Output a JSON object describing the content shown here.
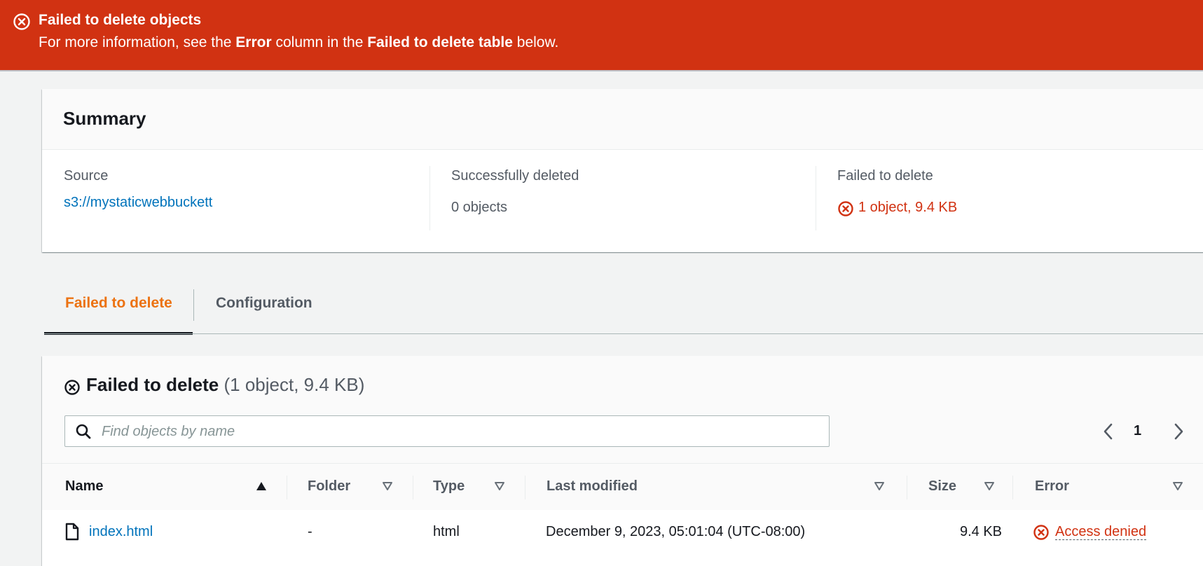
{
  "flash": {
    "title": "Failed to delete objects",
    "msg_prefix": "For more information, see the ",
    "msg_bold1": "Error",
    "msg_mid": " column in the ",
    "msg_bold2": "Failed to delete table",
    "msg_suffix": " below.",
    "icon": "error-circle-x-icon",
    "color": "#d13212"
  },
  "summary": {
    "title": "Summary",
    "source_label": "Source",
    "source_value": "s3://mystaticwebbuckett",
    "success_label": "Successfully deleted",
    "success_value": "0 objects",
    "failed_label": "Failed to delete",
    "failed_value": "1 object, 9.4 KB"
  },
  "tabs": [
    {
      "label": "Failed to delete",
      "active": true
    },
    {
      "label": "Configuration",
      "active": false
    }
  ],
  "failed_table": {
    "title": "Failed to delete",
    "counter": "(1 object, 9.4 KB)",
    "search_placeholder": "Find objects by name",
    "page_number": "1",
    "columns": [
      "Name",
      "Folder",
      "Type",
      "Last modified",
      "Size",
      "Error"
    ],
    "rows": [
      {
        "name": "index.html",
        "folder": "-",
        "type": "html",
        "last_modified": "December 9, 2023, 05:01:04 (UTC-08:00)",
        "size": "9.4 KB",
        "error": "Access denied"
      }
    ]
  },
  "colors": {
    "accent_orange": "#ec7211",
    "link_blue": "#0073bb",
    "error_red": "#d13212"
  }
}
